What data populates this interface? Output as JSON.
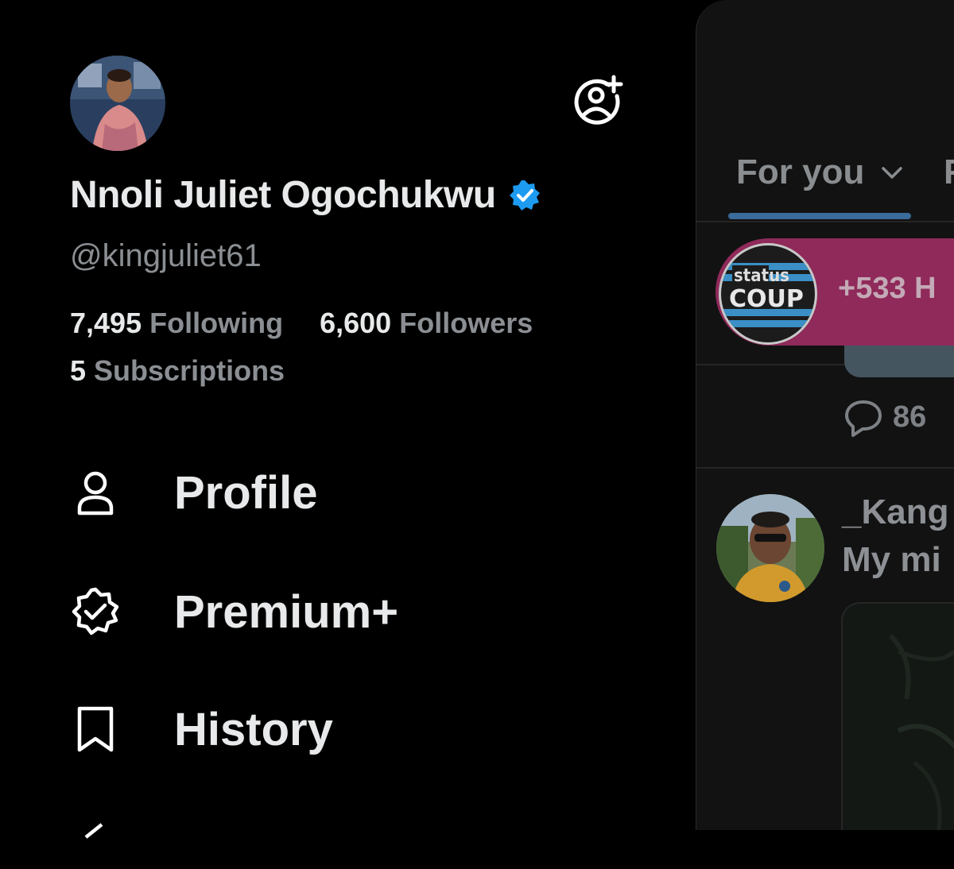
{
  "drawer": {
    "name": "Nnoli Juliet Ogochukwu",
    "handle": "@kingjuliet61",
    "following_count": "7,495",
    "following_label": "Following",
    "followers_count": "6,600",
    "followers_label": "Followers",
    "subscriptions_count": "5",
    "subscriptions_label": "Subscriptions",
    "menu": [
      {
        "label": "Profile",
        "icon": "person-icon"
      },
      {
        "label": "Premium+",
        "icon": "verified-badge-icon"
      },
      {
        "label": "History",
        "icon": "bookmark-icon"
      }
    ]
  },
  "feed": {
    "tab_active": "For you",
    "tab_next": "F",
    "promo": {
      "logo_top": "status",
      "logo_bottom": "COUP",
      "text": "+533 H"
    },
    "reply_count": "86",
    "post": {
      "name": "_Kang",
      "text": "My mi"
    }
  },
  "colors": {
    "background": "#000000",
    "feed_background": "#121212",
    "verified_blue": "#1d9bf0",
    "tab_indicator": "#3a6b9a",
    "promo": "#8f2a5a",
    "muted_text": "#8b8f93"
  }
}
